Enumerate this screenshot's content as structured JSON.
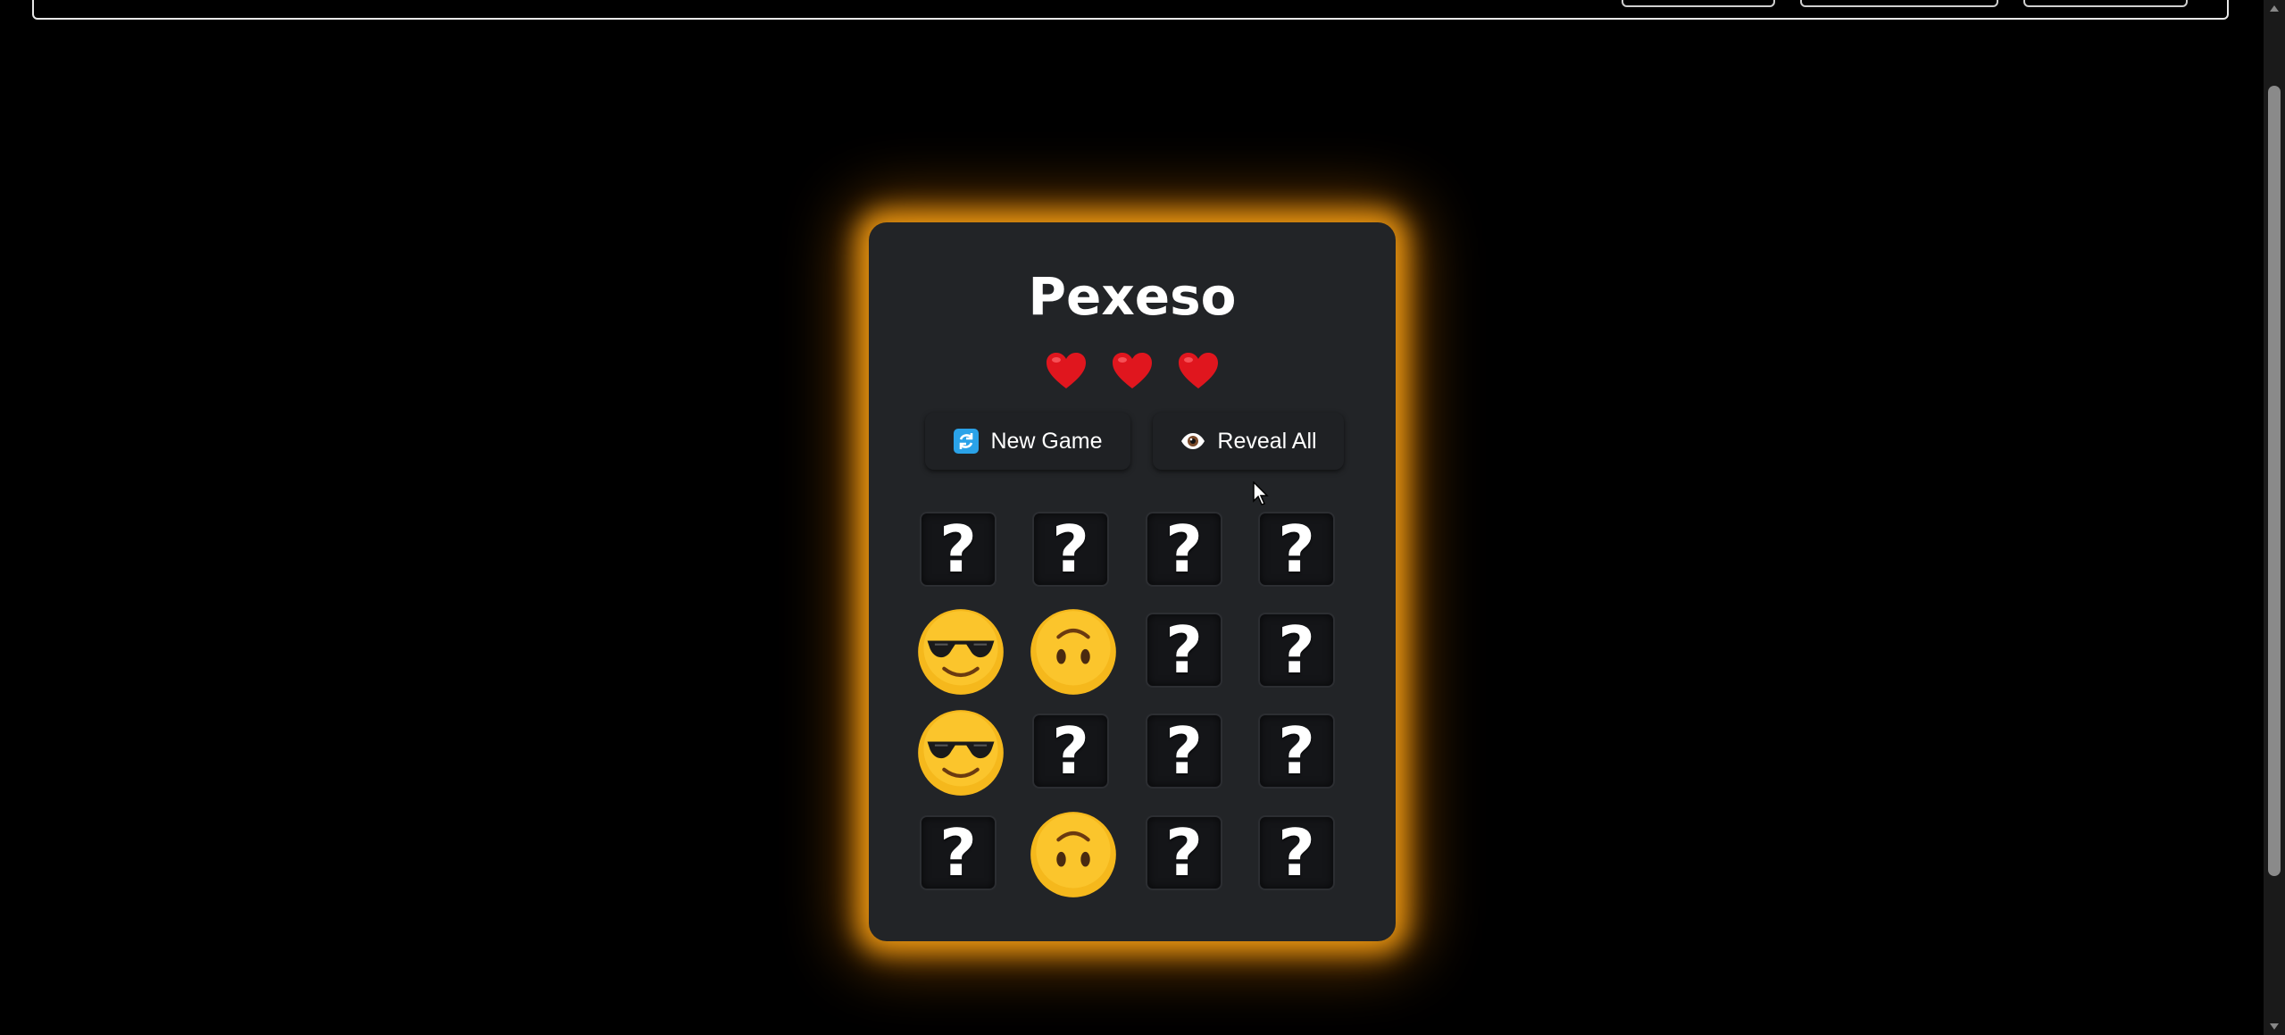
{
  "game": {
    "title": "Pexeso",
    "lives": 3,
    "buttons": {
      "new_game": "New Game",
      "reveal_all": "Reveal All"
    },
    "hidden_symbol": "?",
    "board": [
      [
        "hidden",
        "hidden",
        "hidden",
        "hidden"
      ],
      [
        "smiling-face-with-sunglasses",
        "upside-down-face",
        "hidden",
        "hidden"
      ],
      [
        "smiling-face-with-sunglasses",
        "hidden",
        "hidden",
        "hidden"
      ],
      [
        "hidden",
        "upside-down-face",
        "hidden",
        "hidden"
      ]
    ]
  },
  "icons": {
    "heart": "red-heart-icon",
    "new_game": "refresh-icon",
    "reveal_all": "eye-icon"
  },
  "colors": {
    "background": "#000000",
    "card": "#222427",
    "glow": "#ffa514",
    "heart": "#e0161e",
    "tile": "#141518",
    "emoji_yellow": "#f5b81c"
  }
}
